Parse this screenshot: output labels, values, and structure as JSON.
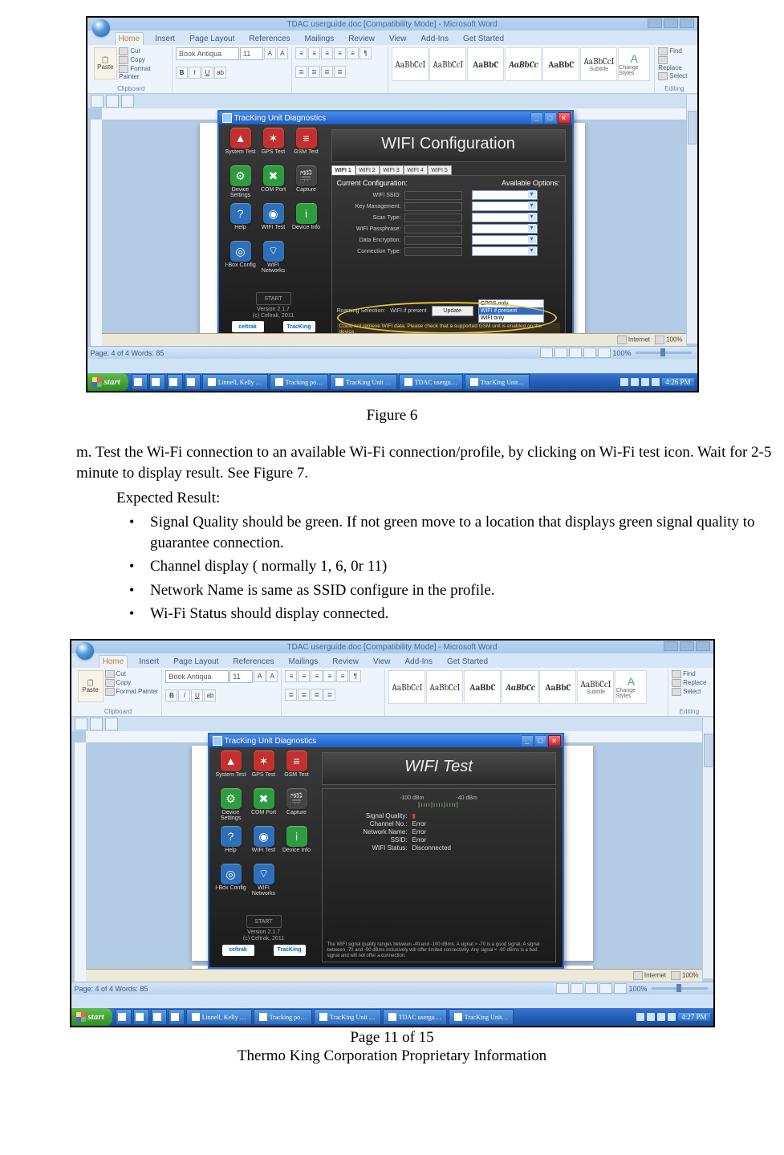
{
  "figure1": {
    "caption": "Figure 6"
  },
  "paragraph_m": "m. Test the Wi-Fi connection to an available Wi-Fi connection/profile, by clicking on Wi-Fi test icon. Wait for 2-5 minute to display result. See Figure 7.",
  "expected_label": "Expected Result:",
  "bullets": [
    "Signal Quality should be green. If not green move to a location that displays green signal quality to guarantee connection.",
    "Channel display ( normally 1, 6, 0r 11)",
    "Network Name is same as SSID configure in the profile.",
    "Wi-Fi Status should display connected."
  ],
  "footer": {
    "page": "Page 11 of 15",
    "prop": "Thermo King Corporation Proprietary Information"
  },
  "word": {
    "title": "TDAC userguide.doc [Compatibility Mode] - Microsoft Word",
    "tabs": [
      "Home",
      "Insert",
      "Page Layout",
      "References",
      "Mailings",
      "Review",
      "View",
      "Add-Ins",
      "Get Started"
    ],
    "font": "Book Antiqua",
    "size": "11",
    "clip": {
      "paste": "Paste",
      "cut": "Cut",
      "copy": "Copy",
      "fmt": "Format Painter",
      "grp": "Clipboard"
    },
    "styles": [
      "AaBbCcI",
      "AaBbCcI",
      "AaBbC",
      "AaBbCc",
      "AaBbC",
      "AaBbCcI"
    ],
    "style_sub": "Subtitle",
    "changest": "Change Styles",
    "editing": {
      "find": "Find",
      "replace": "Replace",
      "select": "Select",
      "grp": "Editing"
    },
    "status_left": "Page: 4 of 4    Words: 85",
    "zoom": "100%"
  },
  "taskbar": {
    "start": "start",
    "items": [
      "Linnell, Kelly …",
      "Tracking po…",
      "TracKing Unit …",
      "TDAC usergu…",
      "TracKing Unit…"
    ],
    "time1": "4:26 PM",
    "time2": "4:27 PM"
  },
  "ie_status": {
    "internet": "Internet",
    "zoom": "100%"
  },
  "diag": {
    "title": "TracKing Unit Diagnostics",
    "icons": [
      {
        "label": "System Test",
        "bg": "#c43030",
        "g": "▲"
      },
      {
        "label": "GPS Test",
        "bg": "#c43030",
        "g": "✶"
      },
      {
        "label": "GSM Test",
        "bg": "#c43030",
        "g": "≡"
      },
      {
        "label": "Device Settings",
        "bg": "#2d9c3e",
        "g": "⚙"
      },
      {
        "label": "COM Port",
        "bg": "#2d9c3e",
        "g": "✖"
      },
      {
        "label": "Capture",
        "bg": "#444",
        "g": "🎬"
      },
      {
        "label": "Help",
        "bg": "#2d6fb8",
        "g": "?"
      },
      {
        "label": "WIFI Test",
        "bg": "#2d6fb8",
        "g": "◉"
      },
      {
        "label": "Device Info",
        "bg": "#2d9c3e",
        "g": "i"
      },
      {
        "label": "I-Box Config",
        "bg": "#2d6fb8",
        "g": "◎"
      },
      {
        "label": "WIFI Networks",
        "bg": "#2d6fb8",
        "g": "⌔"
      }
    ],
    "start_btn": "START",
    "version": "Version 2.1.7\n(c) Celtrak, 2011",
    "logo1": "celtrak",
    "logo2": "TracKing",
    "panel1": {
      "title": "WIFI Configuration",
      "wifi_tabs": [
        "WIFI 1",
        "WIFI 2",
        "WIFI 3",
        "WIFI 4",
        "WIFI 5"
      ],
      "hdr_left": "Current Configuration:",
      "hdr_right": "Available Options:",
      "fields": [
        "WIFI SSID:",
        "Key Management:",
        "Scan Type:",
        "WIFI Passphrase:",
        "Data Encryption:",
        "Connection Type:"
      ],
      "roaming_lbl": "Roaming Selection:",
      "roaming_val": "WIFI if present",
      "update": "Update",
      "options": [
        "GPRS only",
        "WIFI if present",
        "WIFI only"
      ],
      "warn": "Could not retrieve WIFI data.  Please check that a supported GSM unit is enabled on the device."
    },
    "panel2": {
      "title": "WIFI Test",
      "scale_lo": "-100 dBm",
      "scale_hi": "-40 dBm",
      "rows": [
        {
          "label": "Signal Quality:",
          "val": "",
          "red": true
        },
        {
          "label": "Channel No.:",
          "val": "Error"
        },
        {
          "label": "Network Name:",
          "val": "Error"
        },
        {
          "label": "SSID:",
          "val": "Error"
        },
        {
          "label": "WIFI Status:",
          "val": "Disconnected"
        }
      ],
      "foot": "The WIFI signal quality ranges between -40 and -100 dBms.  A signal > -70 is a good signal.  A signal between -70 and -90 dBms inclusively will offer limited connectivity.  Any signal < -90 dBms is a bad signal and will not offer a connection."
    }
  }
}
